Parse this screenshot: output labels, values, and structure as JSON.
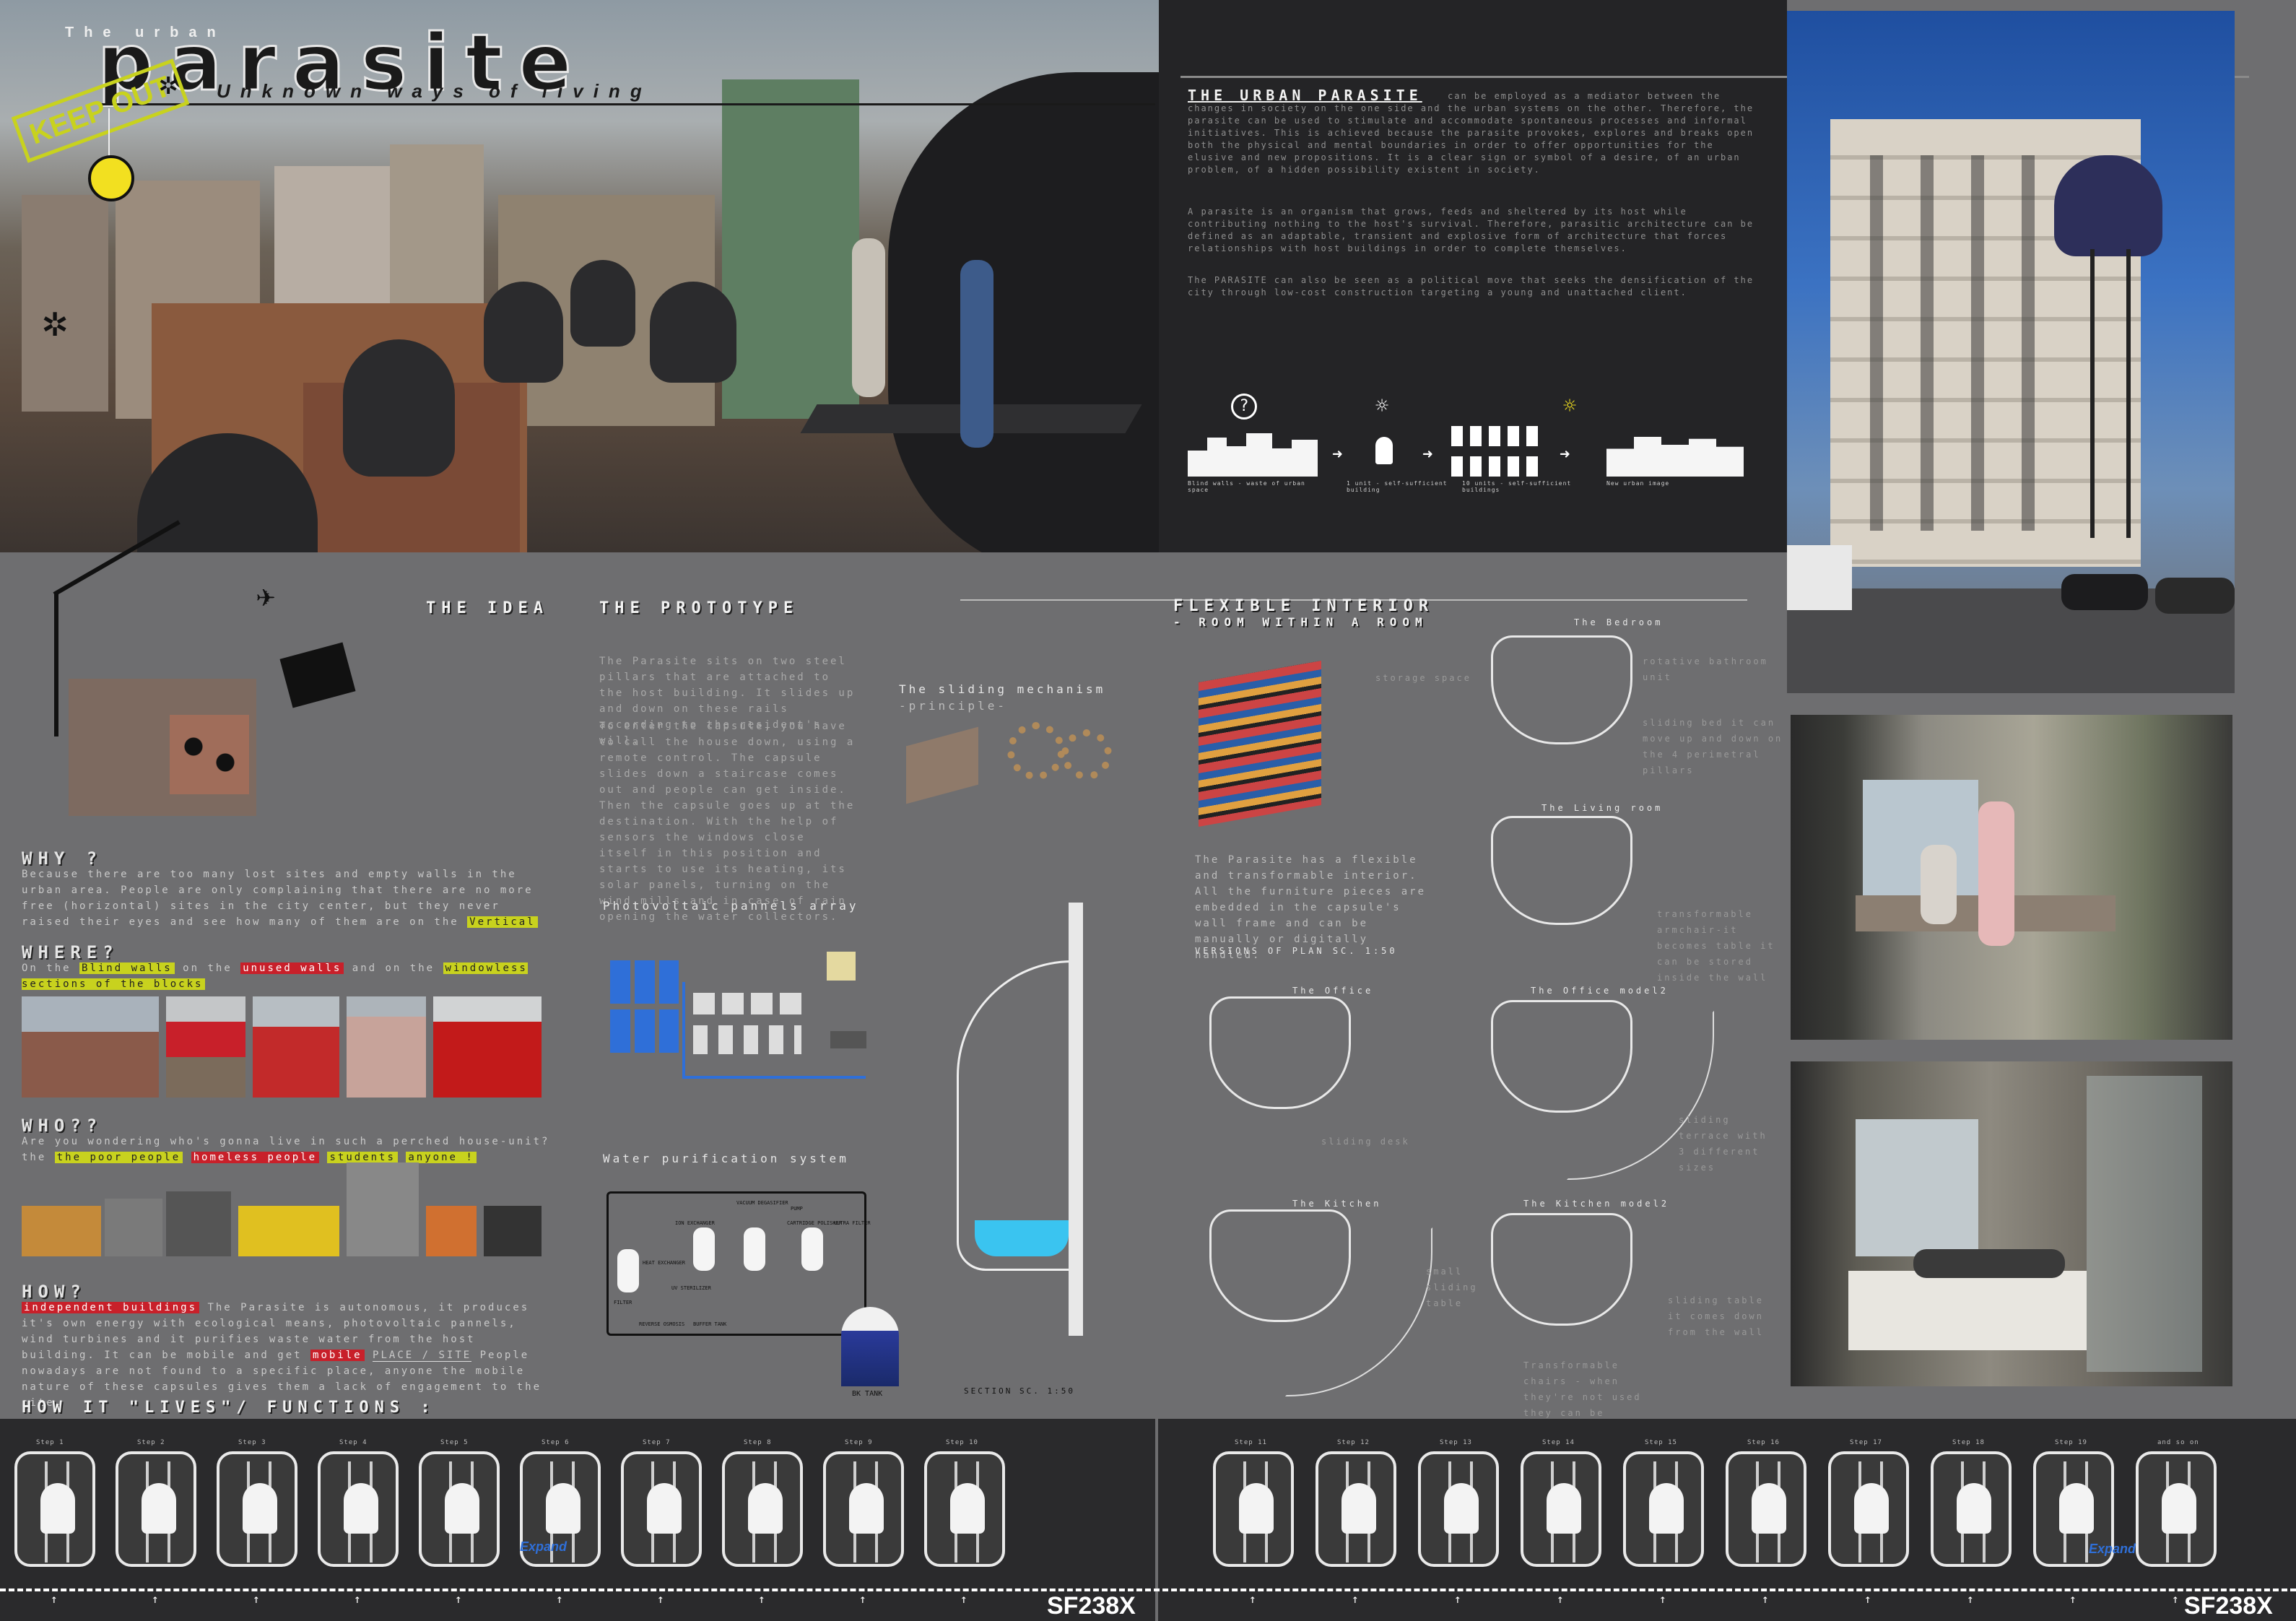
{
  "header": {
    "the_urban": "The urban",
    "parasite": "parasite",
    "subtitle": "Unknown ways of living",
    "keep_out": "KEEP OUT"
  },
  "intro": {
    "title": "THE URBAN PARASITE",
    "p1": "can be employed as a mediator between the changes in society on the one side and the urban systems on the other. Therefore, the parasite can be used to stimulate and accommodate spontaneous processes and informal initiatives. This is achieved because the parasite provokes, explores and breaks open both the physical and mental boundaries in order to offer opportunities for the elusive and new propositions. It is a clear sign or symbol of a desire, of an urban problem, of a hidden possibility existent in society.",
    "p2": "A parasite is an organism that grows, feeds and sheltered by its host while contributing nothing to the host's survival. Therefore, parasitic architecture can be defined as an adaptable, transient and explosive form of architecture that forces relationships with host buildings in order to complete themselves.",
    "p3": "The PARASITE can also be seen as a political move that seeks the densification of the city through low-cost construction targeting a young and unattached client.",
    "diagram_captions": [
      "Blind walls - waste of urban space",
      "1 unit - self-sufficient building",
      "10 units - self-sufficient buildings",
      "New urban image"
    ]
  },
  "idea": {
    "title": "THE IDEA",
    "why_title": "WHY ?",
    "why_text": "Because there are too many lost sites and empty walls in the urban area. People are only complaining that there are no more free (horizontal) sites in the city center, but they never raised their eyes and see how many of them are on the",
    "why_highlight": "Vertical",
    "where_title": "WHERE?",
    "where_text": "On the",
    "where_h1": "Blind walls",
    "where_mid": "on the",
    "where_h2": "unused walls",
    "where_and": "and on the",
    "where_h3": "windowless sections of the blocks",
    "who_title": "WHO??",
    "who_text": "Are you wondering who's gonna live in such a perched house-unit? the",
    "who_h1": "the poor people",
    "who_h2": "homeless people",
    "who_h3": "students",
    "who_h4": "anyone !",
    "how_title": "HOW?",
    "how_text": "The Parasite is autonomous, it produces it's own energy with ecological means, photovoltaic pannels, wind turbines and it purifies waste water from the host building. It can be mobile and get",
    "how_h1": "independent buildings",
    "how_h2": "mobile",
    "how_place": "PLACE / SITE",
    "how_end": "People nowadays are not found to a specific place, anyone the mobile nature of these capsules gives them a lack of engagement to the site."
  },
  "prototype": {
    "title": "THE PROTOTYPE",
    "p1": "The Parasite sits on two steel pillars that are attached to the host building. It slides up and down on these rails according to the resident's will.",
    "p2": "To enter the capsule, you have to call the house down, using a remote control. The capsule slides down a staircase comes out and people can get inside. Then the capsule goes up at the destination. With the help of sensors the windows close itself in this position and starts to use its heating, its solar panels, turning on the wind mills and in case of rain opening the water collectors.",
    "sliding_title": "The sliding mechanism",
    "sliding_sub": "-principle-",
    "pv_title": "Photovoltaic pannels array",
    "water_title": "Water purification system",
    "tank": "BK TANK",
    "section": "SECTION   SC. 1:50",
    "water_labels": [
      "HEAT EXCHANGER",
      "ION EXCHANGER",
      "VACUUM DEGASIFIER",
      "CARTRIDGE POLISHER",
      "ULTRA FILTER",
      "FILTER",
      "UV STERILIZER",
      "PUMP",
      "REVERSE OSMOSIS",
      "BUFFER TANK"
    ]
  },
  "interior": {
    "title": "FLEXIBLE INTERIOR",
    "subtitle": "- ROOM WITHIN A ROOM",
    "text": "The Parasite has a flexible and transformable interior. All the furniture pieces are embedded in the capsule's wall frame and can be manually or digitally handled.",
    "versions": "VERSIONS OF PLAN   SC. 1:50",
    "plans": [
      {
        "name": "The Bedroom"
      },
      {
        "name": "The Living room"
      },
      {
        "name": "The Office"
      },
      {
        "name": "The Office model2"
      },
      {
        "name": "The Kitchen"
      },
      {
        "name": "The Kitchen model2"
      }
    ],
    "notes": {
      "storage": "storage space",
      "bathroom": "rotative bathroom unit",
      "bed": "sliding bed it can move up and down on the 4 perimetral pillars",
      "armchair": "transformable armchair-it becomes table it can be stored inside the wall",
      "desk": "sliding desk",
      "terrace": "sliding terrace with 3 different sizes",
      "small_table": "small sliding table",
      "sliding_table": "sliding table it comes down from the wall",
      "chairs": "Transformable chairs - when they're not used they can be stored inside the wall"
    }
  },
  "functions": {
    "title": "HOW IT \"LIVES\"/ FUNCTIONS :",
    "steps_left": [
      "Step 1",
      "Step 2",
      "Step 3",
      "Step 4",
      "Step 5",
      "Step 6",
      "Step 7",
      "Step 8",
      "Step 9",
      "Step 10"
    ],
    "steps_right": [
      "Step 11",
      "Step 12",
      "Step 13",
      "Step 14",
      "Step 15",
      "Step 16",
      "Step 17",
      "Step 18",
      "Step 19",
      "and so on"
    ],
    "expand": "Expand",
    "code_left": "SF238X",
    "code_right": "SF238X"
  },
  "colors": {
    "dark_panel": "#2a2a2c",
    "mid_panel": "#6e6e70",
    "accent_yellow": "#c8d21e",
    "accent_red": "#c8202a",
    "accent_blue": "#2f6fd8"
  }
}
